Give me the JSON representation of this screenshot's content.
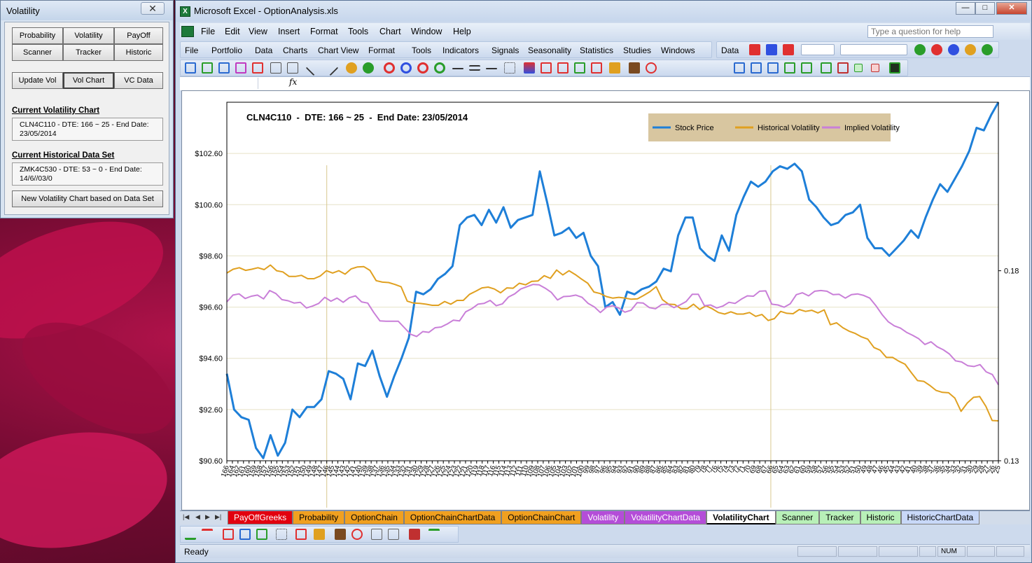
{
  "desktop": {
    "accent": "#b0124a"
  },
  "volatility_window": {
    "title": "Volatility",
    "close_glyph": "✕",
    "buttons": {
      "probability": "Probability",
      "volatility": "Volatility",
      "payoff": "PayOff",
      "scanner": "Scanner",
      "tracker": "Tracker",
      "historic": "Historic",
      "update_vol": "Update Vol",
      "vol_chart": "Vol Chart",
      "vc_data": "VC Data",
      "new_chart": "New Volatility Chart based on Data Set"
    },
    "current_chart_heading": "Current Volatility Chart",
    "current_chart_text": "CLN4C110  -  DTE: 166 ~ 25  -  End Date: 23/05/2014",
    "current_data_heading": "Current Historical Data Set",
    "current_data_text": "ZMK4C530  -  DTE: 53 ~ 0  -  End Date: 14/6//03/0"
  },
  "excel": {
    "title": "Microsoft Excel - OptionAnalysis.xls",
    "icon_letter": "X",
    "window_buttons": {
      "minimize": "—",
      "maximize": "□",
      "close": "✕"
    },
    "menu": [
      "File",
      "Edit",
      "View",
      "Insert",
      "Format",
      "Tools",
      "Chart",
      "Window",
      "Help"
    ],
    "help_placeholder": "Type a question for help",
    "toolbar2": [
      "File",
      "Portfolio",
      "Data",
      "Charts",
      "Chart View",
      "Format",
      "Tools",
      "Indicators",
      "Signals",
      "Seasonality",
      "Statistics",
      "Studies",
      "Windows"
    ],
    "toolbar2_right": "Data",
    "formula_fx": "fx",
    "sheet_tabs": [
      {
        "label": "PayOffGreeks",
        "color": "#e2000f",
        "text": "#ffffff"
      },
      {
        "label": "Probability",
        "color": "#f0a020",
        "text": "#000000"
      },
      {
        "label": "OptionChain",
        "color": "#f0a020",
        "text": "#000000"
      },
      {
        "label": "OptionChainChartData",
        "color": "#f0a020",
        "text": "#000000"
      },
      {
        "label": "OptionChainChart",
        "color": "#f0a020",
        "text": "#000000"
      },
      {
        "label": "Volatility",
        "color": "#b44dd8",
        "text": "#ffffff"
      },
      {
        "label": "VolatilityChartData",
        "color": "#b44dd8",
        "text": "#ffffff"
      },
      {
        "label": "VolatilityChart",
        "color": "#ffffff",
        "text": "#000000"
      },
      {
        "label": "Scanner",
        "color": "#b8f0b8",
        "text": "#000000"
      },
      {
        "label": "Tracker",
        "color": "#b8f0b8",
        "text": "#000000"
      },
      {
        "label": "Historic",
        "color": "#b8f0b8",
        "text": "#000000"
      },
      {
        "label": "HistoricChartData",
        "color": "#c8d8f8",
        "text": "#000000"
      }
    ],
    "status": "Ready",
    "num_indicator": "NUM"
  },
  "chart_data": {
    "type": "line",
    "title": "CLN4C110  -  DTE: 166 ~ 25  -  End Date: 23/05/2014",
    "x_tick_labels": [
      "166",
      "164",
      "162",
      "161",
      "160",
      "159",
      "158",
      "157",
      "156",
      "155",
      "154",
      "153",
      "152",
      "151",
      "150",
      "149",
      "148",
      "147",
      "146",
      "145",
      "144",
      "143",
      "142",
      "141",
      "140",
      "139",
      "138",
      "137",
      "136",
      "135",
      "134",
      "133",
      "132",
      "131",
      "130",
      "129",
      "128",
      "127",
      "126",
      "125",
      "124",
      "123",
      "122",
      "121",
      "120",
      "119",
      "118",
      "117",
      "116",
      "115",
      "114",
      "113",
      "112",
      "111",
      "110",
      "109",
      "108",
      "107",
      "106",
      "105",
      "104",
      "103",
      "102",
      "101",
      "100",
      "99",
      "98",
      "97",
      "96",
      "95",
      "94",
      "93",
      "92",
      "91",
      "90",
      "89",
      "88",
      "87",
      "86",
      "85",
      "84",
      "83",
      "82",
      "81",
      "80",
      "79",
      "78",
      "77",
      "76",
      "75",
      "74",
      "73",
      "72",
      "71",
      "70",
      "69",
      "68",
      "67",
      "66",
      "65",
      "64",
      "63",
      "62",
      "61",
      "60",
      "59",
      "58",
      "57",
      "56",
      "55",
      "54",
      "53",
      "52",
      "51",
      "50",
      "49",
      "48",
      "47",
      "46",
      "45",
      "44",
      "43",
      "42",
      "41",
      "40",
      "39",
      "38",
      "37",
      "36",
      "35",
      "34",
      "33",
      "32",
      "31",
      "30",
      "29",
      "28",
      "27",
      "26",
      "25"
    ],
    "y_left": {
      "ticks": [
        "$90.60",
        "$92.60",
        "$94.60",
        "$96.60",
        "$98.60",
        "$100.60",
        "$102.60"
      ],
      "min": 90.6,
      "max": 104.6
    },
    "y_right": {
      "ticks": [
        "0.13",
        "0.18"
      ],
      "min": 0.13,
      "max": 0.18
    },
    "grid": true,
    "legend_placement": "top-right",
    "legend_bg": "#d8c6a0",
    "vertical_markers_x_index": [
      18,
      98
    ],
    "series": [
      {
        "name": "Stock Price",
        "axis": "left",
        "color": "#1e7fd8",
        "values": [
          94.0,
          92.6,
          92.3,
          92.2,
          91.1,
          90.7,
          91.6,
          90.8,
          91.3,
          92.6,
          92.3,
          92.7,
          92.7,
          93.0,
          94.1,
          94.0,
          93.8,
          93.0,
          94.4,
          94.3,
          94.9,
          93.9,
          93.1,
          93.9,
          94.6,
          95.4,
          97.2,
          97.1,
          97.3,
          97.7,
          97.9,
          98.2,
          99.8,
          100.1,
          100.2,
          99.8,
          100.4,
          99.9,
          100.5,
          99.7,
          100.0,
          100.1,
          100.2,
          101.9,
          100.7,
          99.4,
          99.5,
          99.7,
          99.3,
          99.5,
          98.6,
          98.2,
          96.6,
          96.8,
          96.3,
          97.2,
          97.1,
          97.3,
          97.4,
          97.6,
          98.1,
          98.0,
          99.4,
          100.1,
          100.1,
          98.9,
          98.6,
          98.4,
          99.4,
          98.8,
          100.2,
          100.9,
          101.5,
          101.3,
          101.5,
          101.9,
          102.1,
          102.0,
          102.2,
          101.9,
          100.8,
          100.5,
          100.1,
          99.8,
          99.9,
          100.2,
          100.3,
          100.6,
          99.3,
          98.9,
          98.9,
          98.6,
          98.9,
          99.2,
          99.6,
          99.3,
          100.1,
          100.8,
          101.4,
          101.1,
          101.6,
          102.1,
          102.7,
          103.6,
          103.5,
          104.1,
          104.6
        ]
      },
      {
        "name": "Historical Volatility",
        "axis": "right",
        "color": "#e0a020",
        "values": [
          0.1794,
          0.1804,
          0.1808,
          0.1801,
          0.1804,
          0.1808,
          0.1803,
          0.1815,
          0.18,
          0.1797,
          0.1785,
          0.1785,
          0.1788,
          0.1779,
          0.1779,
          0.1786,
          0.18,
          0.1794,
          0.18,
          0.1791,
          0.1805,
          0.181,
          0.1811,
          0.1801,
          0.1774,
          0.177,
          0.1769,
          0.1764,
          0.1758,
          0.172,
          0.1715,
          0.1714,
          0.1712,
          0.1709,
          0.1709,
          0.1719,
          0.1712,
          0.1722,
          0.1722,
          0.1738,
          0.1746,
          0.1755,
          0.1757,
          0.1752,
          0.1742,
          0.1755,
          0.1754,
          0.1767,
          0.1763,
          0.1772,
          0.1773,
          0.1787,
          0.178,
          0.1802,
          0.1789,
          0.18,
          0.179,
          0.1778,
          0.1767,
          0.1744,
          0.174,
          0.1732,
          0.1728,
          0.173,
          0.1728,
          0.1725,
          0.1726,
          0.1735,
          0.1745,
          0.1758,
          0.1724,
          0.1712,
          0.1711,
          0.17,
          0.17,
          0.1712,
          0.1698,
          0.1708,
          0.17,
          0.169,
          0.1686,
          0.1692,
          0.1686,
          0.1686,
          0.169,
          0.168,
          0.1685,
          0.1669,
          0.1674,
          0.1693,
          0.1688,
          0.1687,
          0.1698,
          0.1693,
          0.1696,
          0.1689,
          0.1697,
          0.1658,
          0.1663,
          0.165,
          0.1641,
          0.1635,
          0.1626,
          0.162,
          0.1598,
          0.1591,
          0.1572,
          0.1572,
          0.1562,
          0.1554,
          0.1532,
          0.1511,
          0.1509,
          0.1498,
          0.1485,
          0.148,
          0.1479,
          0.1465,
          0.143,
          0.1452,
          0.1467,
          0.1469,
          0.1443,
          0.1406,
          0.1405
        ]
      },
      {
        "name": "Implied Volatility",
        "axis": "right",
        "color": "#c97fd8",
        "values": [
          0.1718,
          0.1736,
          0.1739,
          0.1727,
          0.1733,
          0.1736,
          0.1726,
          0.1748,
          0.174,
          0.1724,
          0.1721,
          0.1715,
          0.1717,
          0.1702,
          0.1707,
          0.1714,
          0.173,
          0.172,
          0.1728,
          0.1717,
          0.1729,
          0.1734,
          0.1718,
          0.1715,
          0.169,
          0.1668,
          0.1667,
          0.1667,
          0.1667,
          0.165,
          0.1633,
          0.1627,
          0.164,
          0.1638,
          0.165,
          0.1652,
          0.166,
          0.167,
          0.1668,
          0.1692,
          0.17,
          0.1712,
          0.1714,
          0.1722,
          0.1708,
          0.1713,
          0.1731,
          0.1739,
          0.1752,
          0.1758,
          0.1764,
          0.1763,
          0.1754,
          0.1743,
          0.1723,
          0.1732,
          0.1733,
          0.1736,
          0.173,
          0.1714,
          0.1705,
          0.169,
          0.1704,
          0.1708,
          0.1702,
          0.1691,
          0.1696,
          0.1716,
          0.1715,
          0.1703,
          0.17,
          0.1711,
          0.1712,
          0.1703,
          0.171,
          0.1719,
          0.1738,
          0.1738,
          0.1708,
          0.171,
          0.1702,
          0.1707,
          0.1717,
          0.1714,
          0.1725,
          0.1734,
          0.1733,
          0.1746,
          0.1747,
          0.1712,
          0.171,
          0.1704,
          0.1713,
          0.1737,
          0.1742,
          0.1734,
          0.1746,
          0.1748,
          0.1746,
          0.1737,
          0.1738,
          0.1728,
          0.1737,
          0.1739,
          0.1735,
          0.1728,
          0.1708,
          0.1685,
          0.1666,
          0.1655,
          0.1649,
          0.1638,
          0.163,
          0.1621,
          0.1606,
          0.1613,
          0.16,
          0.1592,
          0.1581,
          0.1563,
          0.156,
          0.155,
          0.1548,
          0.1553,
          0.1534,
          0.1527,
          0.15
        ]
      }
    ]
  }
}
